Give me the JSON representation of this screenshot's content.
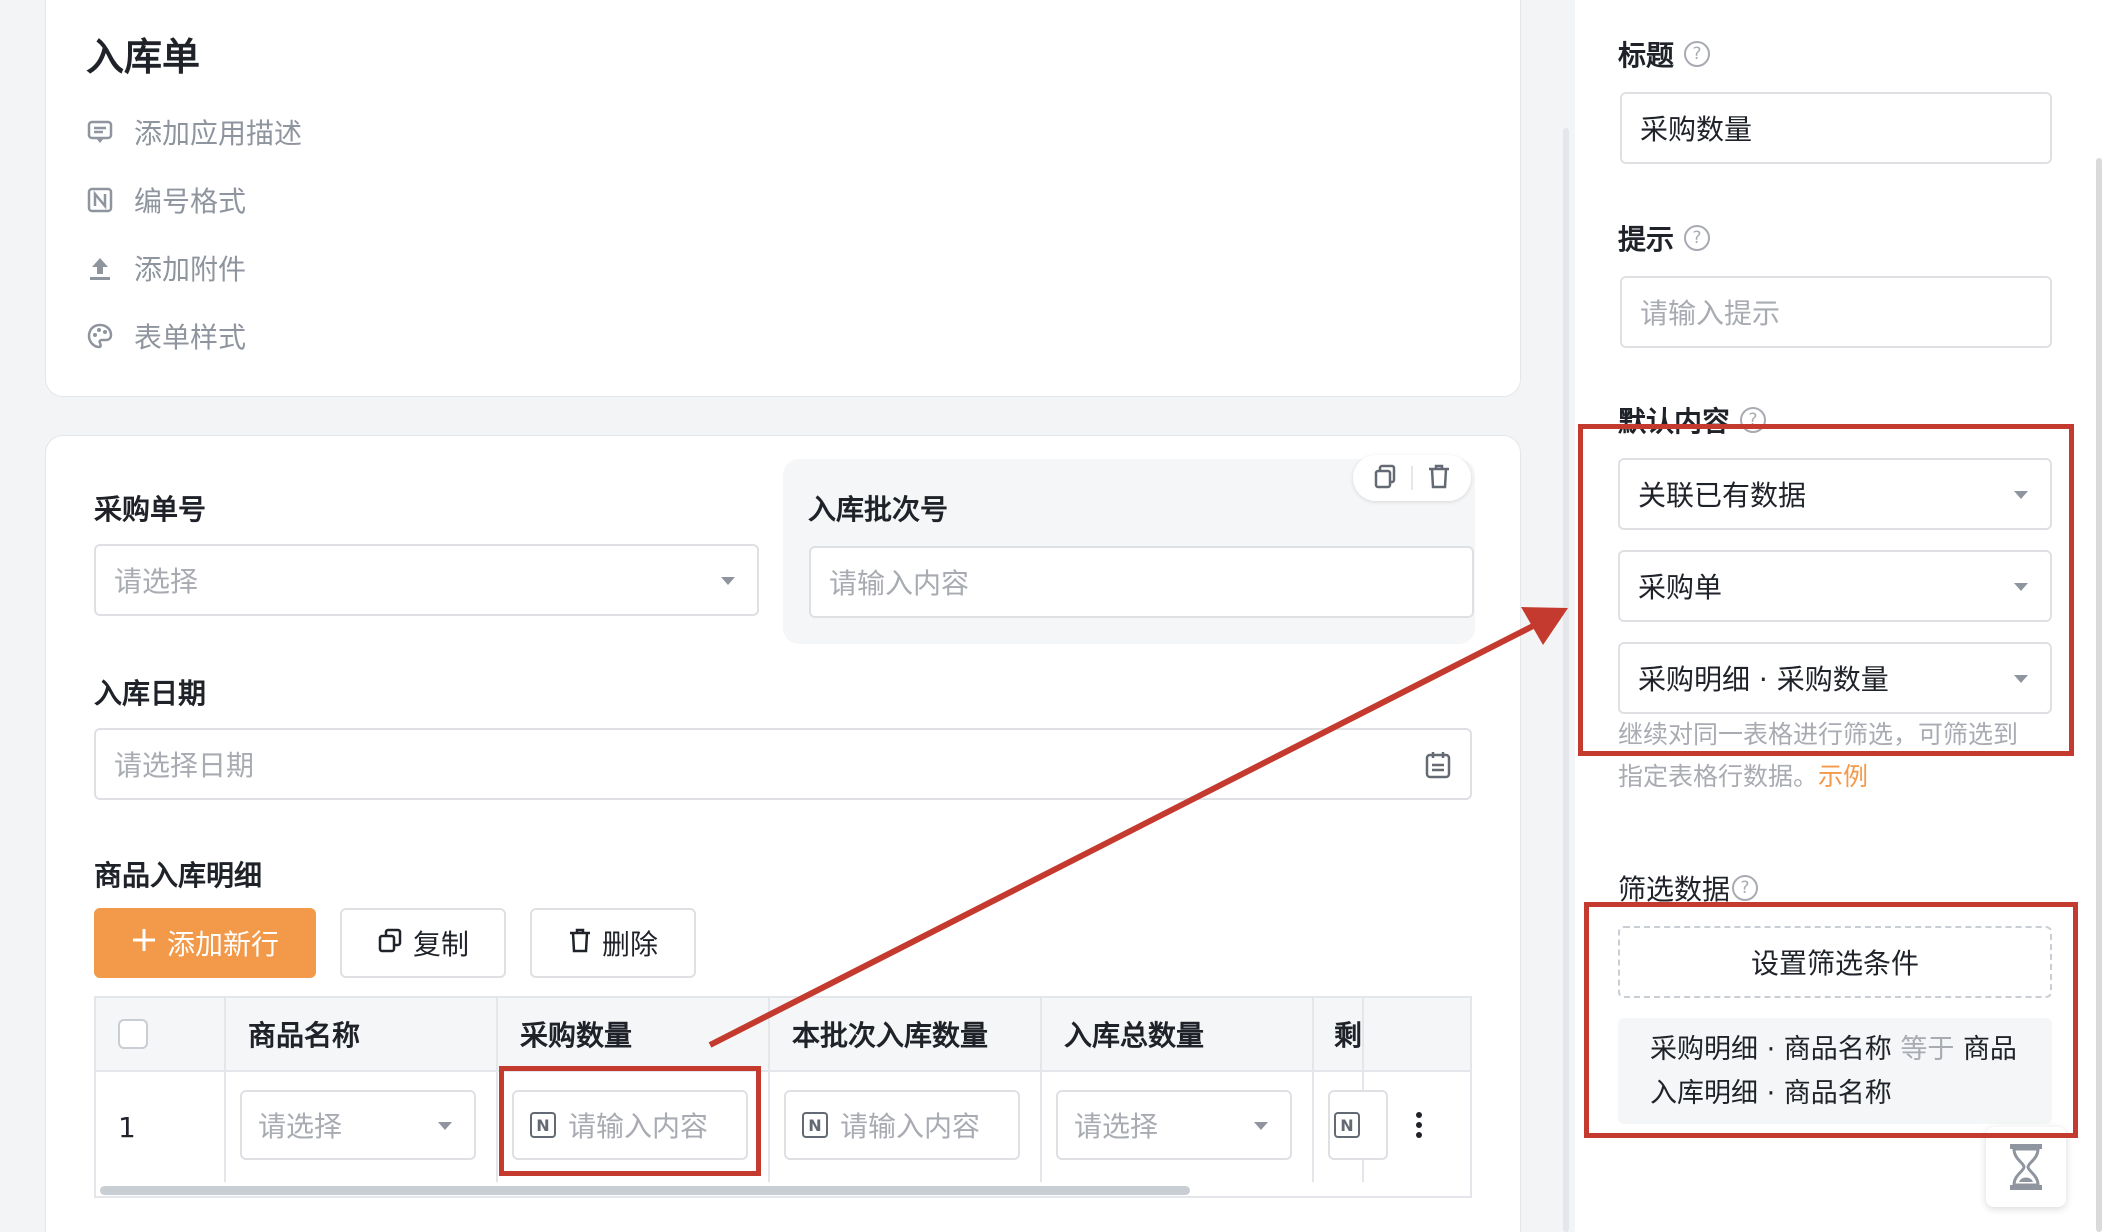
{
  "form": {
    "title": "入库单",
    "menu": [
      {
        "label": "添加应用描述",
        "icon": "comment-icon"
      },
      {
        "label": "编号格式",
        "icon": "number-format-icon"
      },
      {
        "label": "添加附件",
        "icon": "upload-icon"
      },
      {
        "label": "表单样式",
        "icon": "palette-icon"
      }
    ]
  },
  "fields": {
    "purchase_no": {
      "label": "采购单号",
      "placeholder": "请选择"
    },
    "batch_no": {
      "label": "入库批次号",
      "placeholder": "请输入内容"
    },
    "date": {
      "label": "入库日期",
      "placeholder": "请选择日期"
    },
    "detail": {
      "label": "商品入库明细"
    }
  },
  "toolbar": {
    "add_row": "添加新行",
    "copy": "复制",
    "delete": "删除"
  },
  "table": {
    "columns": [
      "商品名称",
      "采购数量",
      "本批次入库数量",
      "入库总数量",
      "剩"
    ],
    "rows": [
      {
        "index": "1",
        "product": "请选择",
        "purchase_qty": "请输入内容",
        "batch_qty": "请输入内容",
        "total_qty": "请选择"
      }
    ]
  },
  "panel": {
    "title_label": "标题",
    "title_value": "采购数量",
    "hint_label": "提示",
    "hint_placeholder": "请输入提示",
    "default_label": "默认内容",
    "default_type": "关联已有数据",
    "default_form": "采购单",
    "default_field": "采购明细 · 采购数量",
    "default_hint": "继续对同一表格进行筛选，可筛选到",
    "default_hint2": "指定表格行数据。",
    "example_link": "示例",
    "filter_label": "筛选数据",
    "filter_button": "设置筛选条件",
    "filter_left": "采购明细 · 商品名称",
    "filter_op": "等于",
    "filter_right": "商品入库明细 · 商品名称"
  },
  "colors": {
    "accent": "#f2994a",
    "annotation": "#c43a2e"
  }
}
